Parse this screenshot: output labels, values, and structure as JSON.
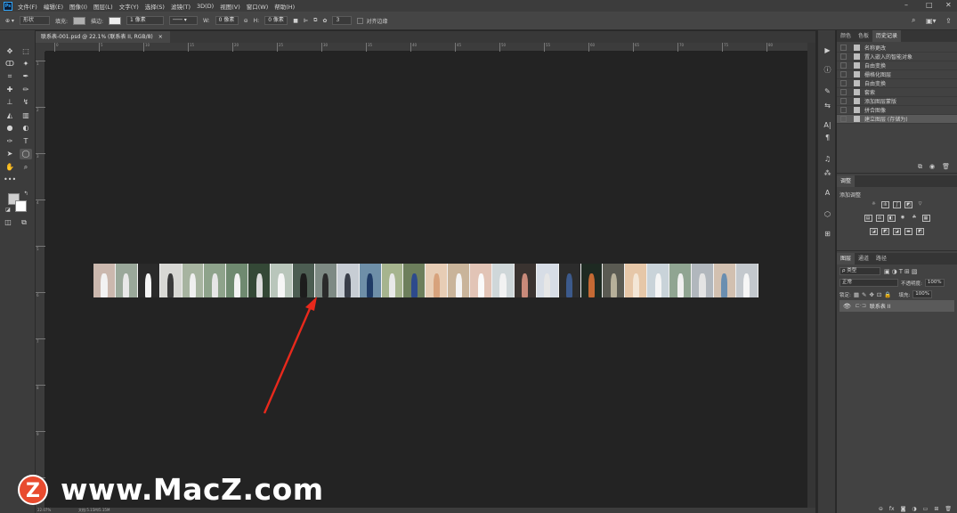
{
  "menubar": {
    "app_icon": "Ps",
    "items": [
      "文件(F)",
      "编辑(E)",
      "图像(I)",
      "图层(L)",
      "文字(Y)",
      "选择(S)",
      "滤镜(T)",
      "3D(D)",
      "视图(V)",
      "窗口(W)",
      "帮助(H)"
    ],
    "window_controls": [
      "–",
      "□",
      "✕"
    ]
  },
  "options": {
    "mode": "形状",
    "fill_label": "填充:",
    "stroke_label": "描边:",
    "stroke_width": "1 像素",
    "w_label": "W:",
    "w_value": "0 像素",
    "h_label": "H:",
    "h_value": "0 像素",
    "radius_value": "3",
    "align_edges": "对齐边缘"
  },
  "document": {
    "tab_title": "联系表-001.psd @ 22.1% (联系表 II, RGB/8)",
    "tab_close": "×"
  },
  "ruler": {
    "h_labels": [
      "0",
      "5",
      "10",
      "15",
      "20",
      "25",
      "30",
      "35",
      "40",
      "45",
      "50",
      "55",
      "60",
      "65",
      "70",
      "75",
      "80"
    ],
    "v_labels": [
      "1",
      "2",
      "3",
      "4",
      "5",
      "6",
      "7",
      "8",
      "9",
      "1"
    ]
  },
  "thumbnails": [
    {
      "bg": "#cbb8ae",
      "fig": "#f2f2f2"
    },
    {
      "bg": "#9aa89a",
      "fig": "#e8e8e8"
    },
    {
      "bg": "#2a2a2a",
      "fig": "#f4f4f4"
    },
    {
      "bg": "#d8d8d4",
      "fig": "#3a3a3a"
    },
    {
      "bg": "#a7b4a0",
      "fig": "#f0f0f0"
    },
    {
      "bg": "#8ea38b",
      "fig": "#e6e6e6"
    },
    {
      "bg": "#6f8a70",
      "fig": "#f3f3f3"
    },
    {
      "bg": "#344836",
      "fig": "#dcdcdc"
    },
    {
      "bg": "#b9c6bb",
      "fig": "#f6f6f6"
    },
    {
      "bg": "#4c5d52",
      "fig": "#1d1d1d"
    },
    {
      "bg": "#7e8a84",
      "fig": "#2b2b2b"
    },
    {
      "bg": "#c7cdd4",
      "fig": "#3a3f4a"
    },
    {
      "bg": "#6e8fa8",
      "fig": "#1f3b66"
    },
    {
      "bg": "#a6b48e",
      "fig": "#e9e9e9"
    },
    {
      "bg": "#6d7f5c",
      "fig": "#2d4a8c"
    },
    {
      "bg": "#e7cdb5",
      "fig": "#d7a27c"
    },
    {
      "bg": "#c9b49a",
      "fig": "#f4f4f4"
    },
    {
      "bg": "#e2c4b6",
      "fig": "#fafafa"
    },
    {
      "bg": "#cfd7d9",
      "fig": "#f2f2f2"
    },
    {
      "bg": "#3a3330",
      "fig": "#c98a7a"
    },
    {
      "bg": "#d7dde6",
      "fig": "#e6e6e6"
    },
    {
      "bg": "#2c2c2c",
      "fig": "#3c5a8c"
    },
    {
      "bg": "#1e2a22",
      "fig": "#c46a34"
    },
    {
      "bg": "#5a5a52",
      "fig": "#b7b09a"
    },
    {
      "bg": "#e6c7a8",
      "fig": "#f3e6d6"
    },
    {
      "bg": "#c9d3d9",
      "fig": "#f5f5f5"
    },
    {
      "bg": "#90a592",
      "fig": "#f0f0f0"
    },
    {
      "bg": "#b1b7bd",
      "fig": "#e4e4e4"
    },
    {
      "bg": "#d2c0b0",
      "fig": "#6a8eb0"
    },
    {
      "bg": "#c3c8cd",
      "fig": "#f6f6f6"
    }
  ],
  "icon_column": [
    "▶",
    "ⓘ",
    "✎",
    "⇆",
    "A|",
    "¶",
    "♫",
    "⁂",
    "A",
    "⬡",
    "⊞"
  ],
  "history": {
    "tabs": [
      "颜色",
      "色板",
      "历史记录"
    ],
    "active_tab": "历史记录",
    "items": [
      "名称更改",
      "置入嵌入的智能对象",
      "自由变换",
      "栅格化图层",
      "自由变换",
      "套索",
      "添加图层蒙版",
      "拼合图像",
      "建立图层 (存储为)"
    ],
    "selected_index": 8,
    "footer_icons": [
      "⧉",
      "◉",
      "🗑"
    ]
  },
  "adjustments": {
    "tabs": [
      "调整"
    ],
    "title": "添加调整"
  },
  "layers": {
    "tabs": [
      "图层",
      "通道",
      "路径"
    ],
    "kind_filter": "ρ 类型",
    "blend_mode": "正常",
    "opacity_label": "不透明度:",
    "opacity_value": "100%",
    "lock_label": "锁定:",
    "fill_label": "填充:",
    "fill_value": "100%",
    "layer_name": "联系表 II"
  },
  "status": {
    "zoom": "22.07%",
    "doc_info": "文档:5.15M/5.15M"
  },
  "watermark": {
    "logo_letter": "Z",
    "text": "www.MacZ.com"
  },
  "colors": {
    "annotation_arrow": "#e8291c",
    "canvas": "#232323"
  }
}
